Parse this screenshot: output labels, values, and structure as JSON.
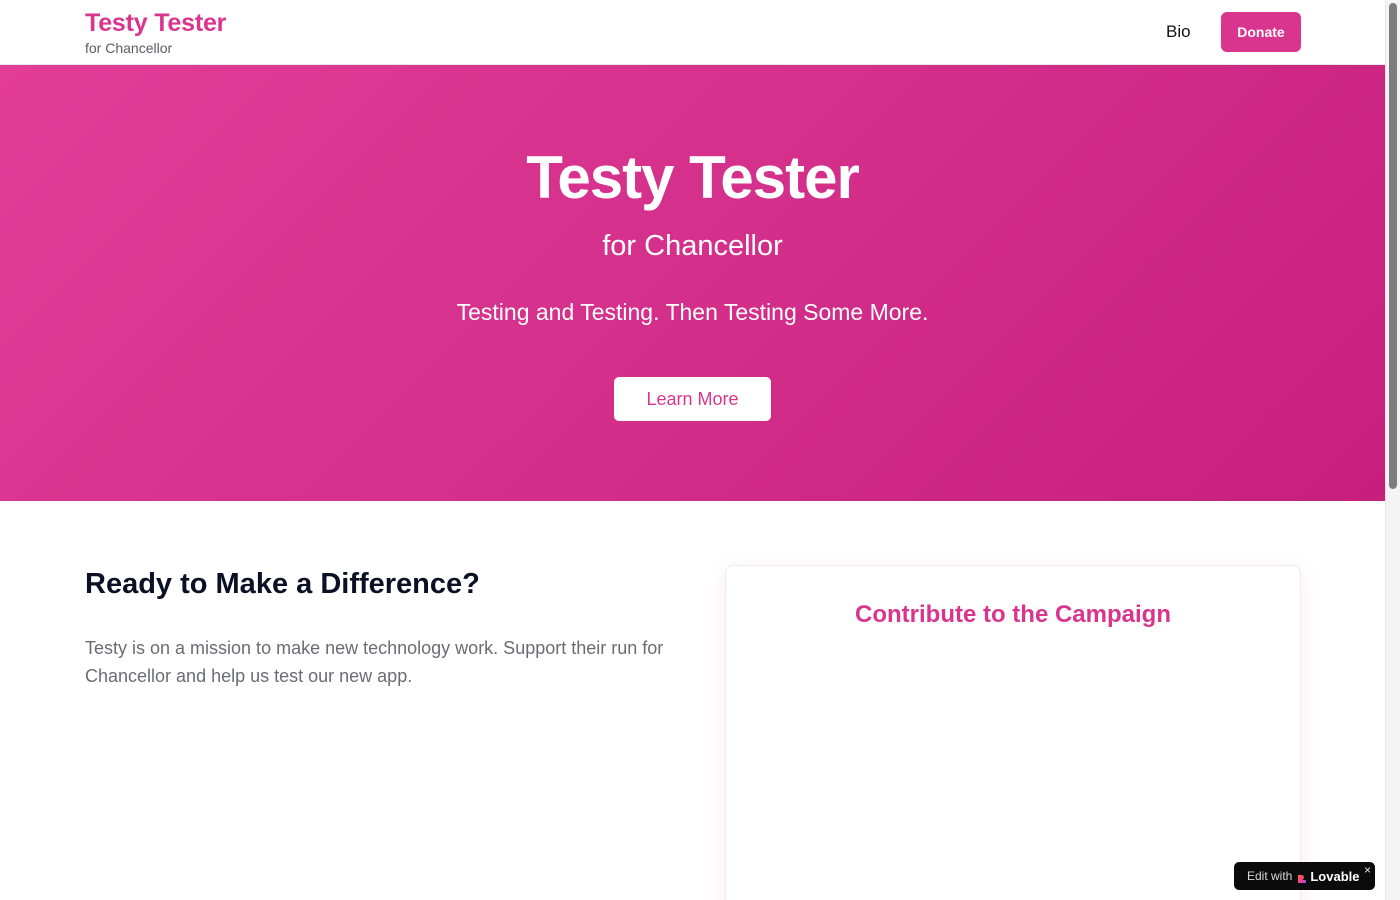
{
  "header": {
    "brand_name": "Testy Tester",
    "brand_sub": "for Chancellor",
    "nav_bio": "Bio",
    "donate_label": "Donate"
  },
  "hero": {
    "title": "Testy Tester",
    "subtitle": "for Chancellor",
    "tagline": "Testing and Testing. Then Testing Some More.",
    "cta_label": "Learn More"
  },
  "mission": {
    "heading": "Ready to Make a Difference?",
    "body": "Testy is on a mission to make new technology work. Support their run for Chancellor and help us test our new app."
  },
  "contribute": {
    "title": "Contribute to the Campaign"
  },
  "badge": {
    "edit_text": "Edit with",
    "brand": "Lovable",
    "close": "×"
  },
  "colors": {
    "brand": "#d9358f",
    "hero_start": "#e23d97",
    "hero_end": "#c71f7c"
  }
}
